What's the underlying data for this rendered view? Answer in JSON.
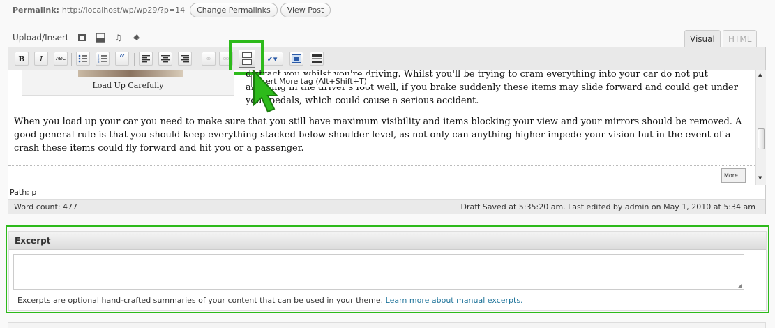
{
  "permalink": {
    "label": "Permalink:",
    "url": "http://localhost/wp/wp29/?p=14",
    "change_button": "Change Permalinks",
    "view_button": "View Post"
  },
  "upload": {
    "label": "Upload/Insert",
    "icons": [
      "add-image-icon",
      "add-video-icon",
      "add-audio-icon",
      "add-media-icon"
    ]
  },
  "tabs": {
    "visual": "Visual",
    "html": "HTML"
  },
  "toolbar": {
    "bold": "B",
    "italic": "I",
    "strike": "ABC",
    "tooltip": "Insert More tag (Alt+Shift+T)"
  },
  "content": {
    "image_caption": "Load Up Carefully",
    "para_right": "distract you whilst you're driving. Whilst you'll be trying to cram everything into your car do not put anything in the driver's foot well, if you brake suddenly these items may slide forward and could get under your pedals, which could cause a serious accident.",
    "para_full": "When you load up your car you need to make sure that you still have maximum visibility and items blocking your view and your mirrors should be removed. A good general rule is that you should keep everything stacked below shoulder level, as not only can anything higher impede your vision but in the event of a crash these items could fly forward and hit you or a passenger.",
    "more_tag": "More..."
  },
  "status": {
    "path": "Path: p",
    "word_count": "Word count: 477",
    "draft": "Draft Saved at 5:35:20 am. Last edited by admin on May 1, 2010 at 5:34 am"
  },
  "excerpt": {
    "title": "Excerpt",
    "value": "",
    "help": "Excerpts are optional hand-crafted summaries of your content that can be used in your theme.",
    "link": "Learn more about manual excerpts."
  },
  "colors": {
    "highlight": "#2dba1b",
    "link": "#21759b"
  }
}
